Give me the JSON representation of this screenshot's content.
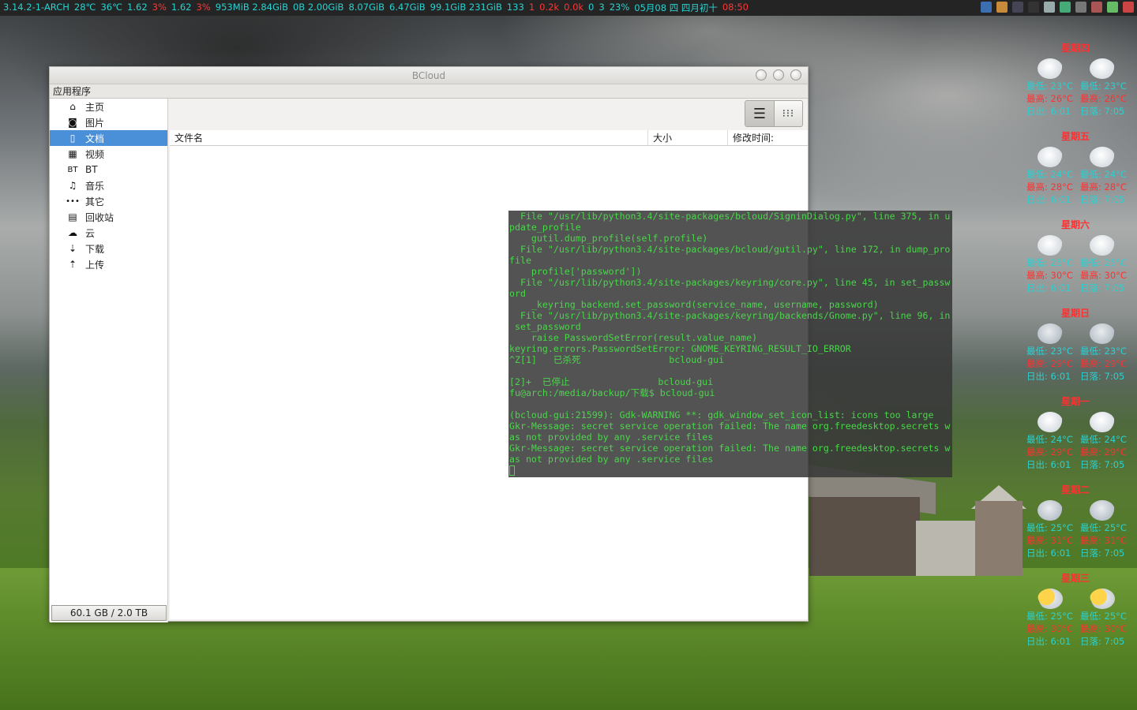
{
  "panel": {
    "stats": [
      {
        "text": "3.14.2-1-ARCH",
        "icon": "kernel-icon",
        "color": "#2ad1d1"
      },
      {
        "text": "28℃",
        "icon": "cpu-temp-icon",
        "color": "#2ad1d1"
      },
      {
        "text": "36℃",
        "icon": "hdd-temp-icon",
        "color": "#2ad1d1"
      },
      {
        "text": "1.62",
        "icon": "cpu1-icon",
        "color": "#2ad1d1"
      },
      {
        "text": "3%",
        "color": "#ff3535"
      },
      {
        "text": "1.62",
        "icon": "cpu2-icon",
        "color": "#2ad1d1"
      },
      {
        "text": "3%",
        "color": "#ff3535"
      },
      {
        "text": "953MiB 2.84GiB",
        "icon": "memory-icon",
        "color": "#2ad1d1"
      },
      {
        "text": "0B  2.00GiB",
        "icon": "swap-icon",
        "color": "#2ad1d1"
      },
      {
        "text": "8.07GiB",
        "icon": "disk-icon",
        "color": "#2ad1d1"
      },
      {
        "text": "6.47GiB",
        "icon": "home-disk-icon",
        "color": "#2ad1d1"
      },
      {
        "text": "99.1GiB 231GiB",
        "icon": "data-disk-icon",
        "color": "#2ad1d1"
      },
      {
        "text": "133",
        "icon": "process-icon",
        "color": "#2ad1d1"
      },
      {
        "text": "1",
        "color": "#ff3535"
      },
      {
        "text": "0.2k",
        "icon": "download-speed-icon",
        "color": "#ff3535"
      },
      {
        "text": "0.0k",
        "icon": "upload-speed-icon",
        "color": "#ff3535"
      },
      {
        "text": "0",
        "icon": "download-count-icon",
        "color": "#2ad1d1"
      },
      {
        "text": "3",
        "icon": "upload-count-icon",
        "color": "#2ad1d1"
      },
      {
        "text": "23%",
        "icon": "volume-icon",
        "color": "#2ad1d1"
      },
      {
        "text": "05月08 四 四月初十",
        "color": "#2ad1d1"
      },
      {
        "text": "08:50",
        "color": "#ff3535"
      }
    ],
    "tray_icons": [
      "tray-app-icon",
      "tray-folder-icon",
      "tray-terminal-icon",
      "tray-window-icon",
      "tray-recycle-icon",
      "tray-network-icon",
      "tray-battery-icon",
      "tray-clipboard-icon",
      "tray-update-icon",
      "tray-power-icon"
    ]
  },
  "window": {
    "title": "BCloud",
    "menu_label": "应用程序",
    "sidebar": [
      {
        "label": "主页",
        "icon": "home-icon",
        "glyph": "⌂"
      },
      {
        "label": "图片",
        "icon": "camera-icon",
        "glyph": "◙"
      },
      {
        "label": "文档",
        "icon": "document-icon",
        "glyph": "▯",
        "selected": true
      },
      {
        "label": "视频",
        "icon": "film-icon",
        "glyph": "▦"
      },
      {
        "label": "BT",
        "icon": "bt-icon",
        "glyph": "BT"
      },
      {
        "label": "音乐",
        "icon": "music-icon",
        "glyph": "♫"
      },
      {
        "label": "其它",
        "icon": "more-icon",
        "glyph": "•••"
      },
      {
        "label": "回收站",
        "icon": "trash-icon",
        "glyph": "▤"
      },
      {
        "label": "云",
        "icon": "cloud-icon",
        "glyph": "☁"
      },
      {
        "label": "下载",
        "icon": "download-icon",
        "glyph": "⇣"
      },
      {
        "label": "上传",
        "icon": "upload-icon",
        "glyph": "⇡"
      }
    ],
    "quota": "60.1 GB / 2.0 TB",
    "columns": {
      "name": "文件名",
      "size": "大小",
      "modified": "修改时间:"
    }
  },
  "terminal": {
    "lines": [
      "  File \"/usr/lib/python3.4/site-packages/bcloud/SigninDialog.py\", line 375, in u",
      "pdate_profile",
      "    gutil.dump_profile(self.profile)",
      "  File \"/usr/lib/python3.4/site-packages/bcloud/gutil.py\", line 172, in dump_pro",
      "file",
      "    profile['password'])",
      "  File \"/usr/lib/python3.4/site-packages/keyring/core.py\", line 45, in set_passw",
      "ord",
      "    _keyring_backend.set_password(service_name, username, password)",
      "  File \"/usr/lib/python3.4/site-packages/keyring/backends/Gnome.py\", line 96, in",
      " set_password",
      "    raise PasswordSetError(result.value_name)",
      "keyring.errors.PasswordSetError: GNOME_KEYRING_RESULT_IO_ERROR",
      "^Z[1]   已杀死                bcloud-gui",
      "",
      "[2]+  已停止                bcloud-gui",
      "fu@arch:/media/backup/下载$ bcloud-gui",
      "",
      "(bcloud-gui:21599): Gdk-WARNING **: gdk_window_set_icon_list: icons too large",
      "Gkr-Message: secret service operation failed: The name org.freedesktop.secrets w",
      "as not provided by any .service files",
      "Gkr-Message: secret service operation failed: The name org.freedesktop.secrets w",
      "as not provided by any .service files"
    ]
  },
  "weather": [
    {
      "day": "星期四",
      "icon": "cloud-icon",
      "lo": "最低: 23°C",
      "hi": "最高: 26°C",
      "rise": "日出: 6:01",
      "set": "日落: 7:05",
      "lo2": "最低: 23°C",
      "hi2": "最高: 26°C"
    },
    {
      "day": "星期五",
      "icon": "cloud-icon",
      "lo": "最低: 24°C",
      "hi": "最高: 28°C",
      "rise": "日出: 6:01",
      "set": "日落: 7:05",
      "lo2": "最低: 24°C",
      "hi2": "最高: 28°C"
    },
    {
      "day": "星期六",
      "icon": "cloud-icon",
      "lo": "最低: 25°C",
      "hi": "最高: 30°C",
      "rise": "日出: 6:01",
      "set": "日落: 7:05",
      "lo2": "最低: 25°C",
      "hi2": "最高: 30°C"
    },
    {
      "day": "星期日",
      "icon": "thunderstorm-icon",
      "lo": "最低: 23°C",
      "hi": "最高: 29°C",
      "rise": "日出: 6:01",
      "set": "日落: 7:05",
      "lo2": "最低: 23°C",
      "hi2": "最高: 29°C"
    },
    {
      "day": "星期一",
      "icon": "cloud-icon",
      "lo": "最低: 24°C",
      "hi": "最高: 29°C",
      "rise": "日出: 6:01",
      "set": "日落: 7:05",
      "lo2": "最低: 24°C",
      "hi2": "最高: 29°C"
    },
    {
      "day": "星期二",
      "icon": "thunderstorm-icon",
      "lo": "最低: 25°C",
      "hi": "最高: 31°C",
      "rise": "日出: 6:01",
      "set": "日落: 7:05",
      "lo2": "最低: 25°C",
      "hi2": "最高: 31°C"
    },
    {
      "day": "星期三",
      "icon": "sun-thunderstorm-icon",
      "lo": "最低: 25°C",
      "hi": "最高: 30°C",
      "rise": "日出: 6:01",
      "set": "日落: 7:05",
      "lo2": "最低: 25°C",
      "hi2": "最高: 30°C"
    }
  ]
}
